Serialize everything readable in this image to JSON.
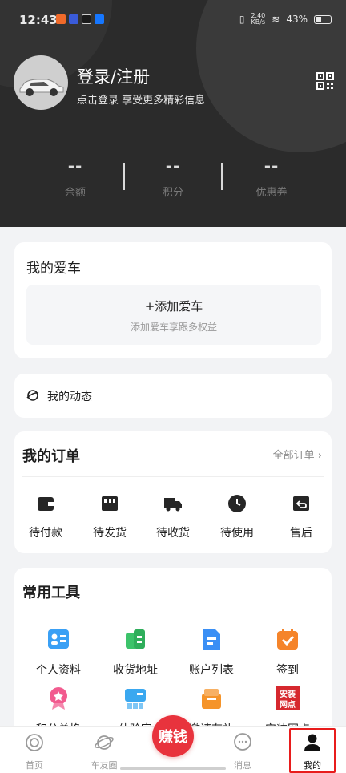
{
  "status_bar": {
    "time": "12:43",
    "network_speed": "2.40\nKB/s",
    "battery": "43%",
    "battery_level": 0.43
  },
  "profile": {
    "title": "登录/注册",
    "subtitle": "点击登录 享受更多精彩信息",
    "qr_icon": "qr-code-icon"
  },
  "stats": [
    {
      "value": "--",
      "label": "余额"
    },
    {
      "value": "--",
      "label": "积分"
    },
    {
      "value": "--",
      "label": "优惠券"
    }
  ],
  "car": {
    "title": "我的爱车",
    "add_label": "+添加爱车",
    "add_sub": "添加爱车享跟多权益"
  },
  "dynamics": {
    "label": "我的动态"
  },
  "orders": {
    "title": "我的订单",
    "all_label": "全部订单",
    "items": [
      {
        "label": "待付款",
        "icon": "wallet-icon"
      },
      {
        "label": "待发货",
        "icon": "box-icon"
      },
      {
        "label": "待收货",
        "icon": "truck-icon"
      },
      {
        "label": "待使用",
        "icon": "clock-icon"
      },
      {
        "label": "售后",
        "icon": "return-box-icon"
      }
    ]
  },
  "tools": {
    "title": "常用工具",
    "items": [
      {
        "label": "个人资料",
        "icon": "profile-card-icon",
        "color": "#3aa0f5"
      },
      {
        "label": "收货地址",
        "icon": "address-icon",
        "color": "#3cc36a"
      },
      {
        "label": "账户列表",
        "icon": "document-icon",
        "color": "#3a8ff5"
      },
      {
        "label": "签到",
        "icon": "calendar-check-icon",
        "color": "#f5842a"
      },
      {
        "label": "积分兑换",
        "icon": "medal-icon",
        "color": "#f25b8f"
      },
      {
        "label": "体验官",
        "icon": "experience-icon",
        "color": "#3aa8f0"
      },
      {
        "label": "邀请有礼",
        "icon": "gift-box-icon",
        "color": "#f5942a"
      },
      {
        "label": "安装网点",
        "icon": "install-store-icon",
        "color": "#d6282e",
        "logo_text": "安装网点"
      }
    ]
  },
  "nav": {
    "items": [
      {
        "label": "首页",
        "icon": "home-icon"
      },
      {
        "label": "车友圈",
        "icon": "planet-icon"
      },
      {
        "label": "赚钱",
        "icon": "earn-icon"
      },
      {
        "label": "消息",
        "icon": "message-icon"
      },
      {
        "label": "我的",
        "icon": "user-icon"
      }
    ],
    "active": "我的"
  }
}
